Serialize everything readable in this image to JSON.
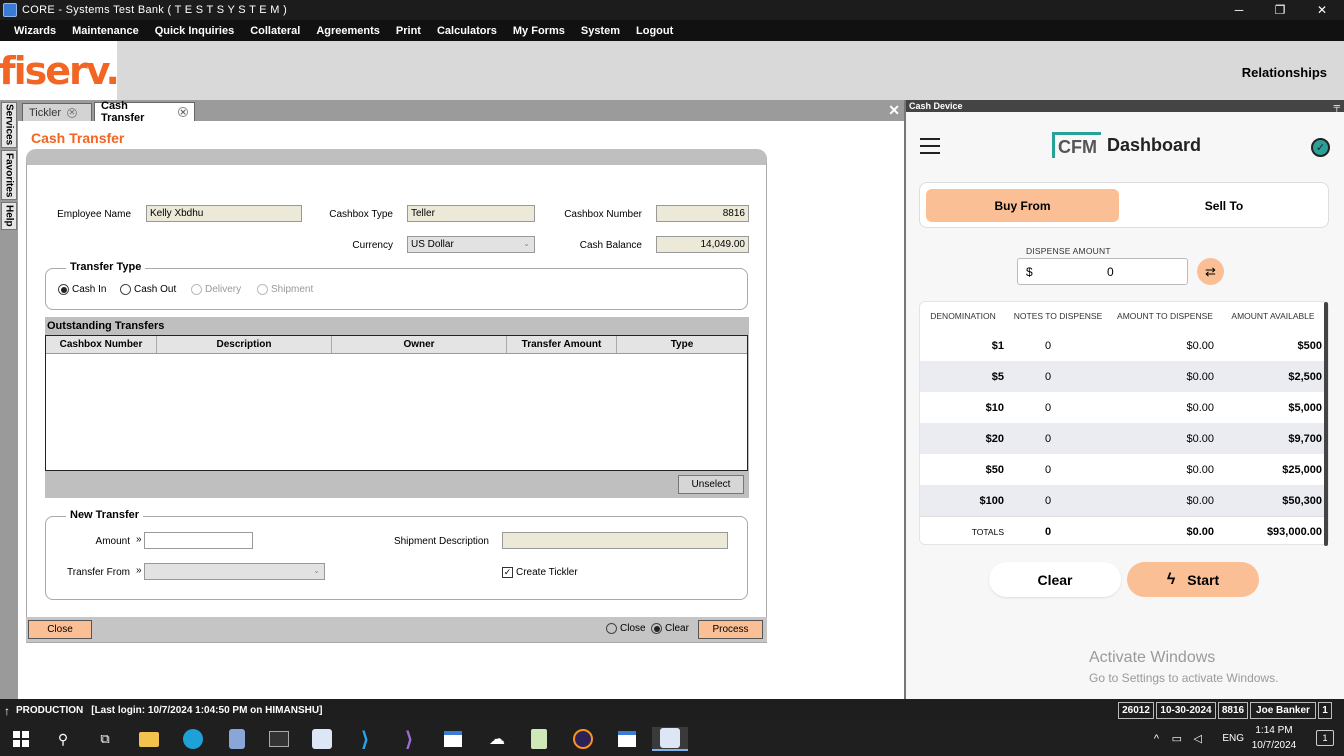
{
  "window": {
    "title": "CORE - Systems Test Bank ( T E S T   S Y S T E M )",
    "minimize": "─",
    "maximize": "❐",
    "close": "✕"
  },
  "menu": [
    "Wizards",
    "Maintenance",
    "Quick Inquiries",
    "Collateral",
    "Agreements",
    "Print",
    "Calculators",
    "My Forms",
    "System",
    "Logout"
  ],
  "brand": {
    "logo": "fiserv.",
    "relationships": "Relationships"
  },
  "side_tabs": [
    "Services",
    "Favorites",
    "Help"
  ],
  "tabs": [
    {
      "label": "Tickler",
      "active": false
    },
    {
      "label": "Cash Transfer",
      "active": true
    }
  ],
  "panel_close": "✕",
  "cash_transfer": {
    "title": "Cash Transfer",
    "employee_name_label": "Employee Name",
    "employee_name": "Kelly Xbdhu",
    "cashbox_type_label": "Cashbox Type",
    "cashbox_type": "Teller",
    "cashbox_number_label": "Cashbox Number",
    "cashbox_number": "8816",
    "currency_label": "Currency",
    "currency": "US Dollar",
    "cash_balance_label": "Cash Balance",
    "cash_balance": "14,049.00",
    "transfer_type_title": "Transfer Type",
    "transfer_types": [
      {
        "label": "Cash In",
        "checked": true,
        "enabled": true
      },
      {
        "label": "Cash Out",
        "checked": false,
        "enabled": true
      },
      {
        "label": "Delivery",
        "checked": false,
        "enabled": false
      },
      {
        "label": "Shipment",
        "checked": false,
        "enabled": false
      }
    ],
    "outstanding_title": "Outstanding Transfers",
    "outstanding_columns": [
      "Cashbox Number",
      "Description",
      "Owner",
      "Transfer Amount",
      "Type"
    ],
    "unselect": "Unselect",
    "new_transfer_title": "New Transfer",
    "amount_label": "Amount",
    "amount": "",
    "shipment_description_label": "Shipment Description",
    "transfer_from_label": "Transfer From",
    "create_tickler_label": "Create Tickler",
    "create_tickler": true,
    "arrow_glyph": "»",
    "close_btn": "Close",
    "close_radio": "Close",
    "clear_radio": "Clear",
    "process_btn": "Process"
  },
  "cash_device": {
    "header": "Cash Device",
    "logo": "CFM",
    "title": "Dashboard",
    "buy_from": "Buy From",
    "sell_to": "Sell To",
    "dispense_label": "DISPENSE AMOUNT",
    "currency_symbol": "$",
    "dispense_value": "0",
    "columns": [
      "DENOMINATION",
      "NOTES TO DISPENSE",
      "AMOUNT TO DISPENSE",
      "AMOUNT AVAILABLE"
    ],
    "rows": [
      {
        "denom": "$1",
        "notes": "0",
        "amount": "$0.00",
        "available": "$500"
      },
      {
        "denom": "$5",
        "notes": "0",
        "amount": "$0.00",
        "available": "$2,500"
      },
      {
        "denom": "$10",
        "notes": "0",
        "amount": "$0.00",
        "available": "$5,000"
      },
      {
        "denom": "$20",
        "notes": "0",
        "amount": "$0.00",
        "available": "$9,700"
      },
      {
        "denom": "$50",
        "notes": "0",
        "amount": "$0.00",
        "available": "$25,000"
      },
      {
        "denom": "$100",
        "notes": "0",
        "amount": "$0.00",
        "available": "$50,300"
      }
    ],
    "totals": {
      "label": "TOTALS",
      "notes": "0",
      "amount": "$0.00",
      "available": "$93,000.00"
    },
    "clear": "Clear",
    "start": "Start",
    "activate_title": "Activate Windows",
    "activate_sub": "Go to Settings to activate Windows."
  },
  "status": {
    "env": "PRODUCTION",
    "last_login": "[Last login: 10/7/2024 1:04:50 PM on HIMANSHU]",
    "boxes": [
      "26012",
      "10-30-2024",
      "8816",
      "Joe Banker",
      "1"
    ]
  },
  "taskbar": {
    "lang": "ENG",
    "time": "1:14 PM",
    "date": "10/7/2024",
    "notification_count": "1"
  },
  "colors": {
    "accent": "#f26522",
    "button": "#fbbf95",
    "cfm_teal": "#2aa198"
  }
}
